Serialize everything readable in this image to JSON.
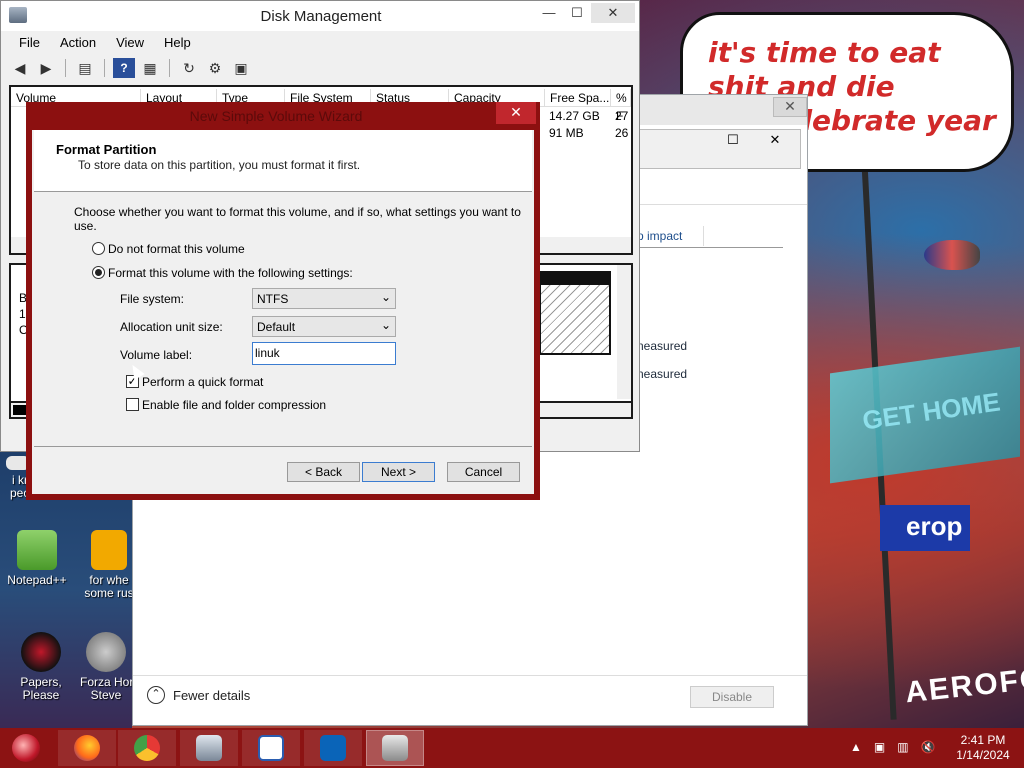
{
  "desktop": {
    "speech_bubble_text": "it's time to eat shit and die andcelebrate year",
    "sign_text": "GET HOME",
    "blue_sign_text": "erop",
    "aero_text": "AEROFOS",
    "icons": [
      {
        "label": "i kr\npeo",
        "icon": "text-doc-icon"
      },
      {
        "label": "Notepad++",
        "icon": "notepad-plus-icon"
      },
      {
        "label": "for whe\nsome rus",
        "icon": "dj-icon"
      },
      {
        "label": "Papers, Please",
        "icon": "papers-please-icon"
      },
      {
        "label": "Forza Hor\nSteve",
        "icon": "flash-icon"
      }
    ]
  },
  "disk_management": {
    "title": "Disk Management",
    "menu": [
      "File",
      "Action",
      "View",
      "Help"
    ],
    "columns": [
      "Volume",
      "Layout",
      "Type",
      "File System",
      "Status",
      "Capacity",
      "Free Spa...",
      "% F"
    ],
    "rows": [
      {
        "free_space": "14.27 GB",
        "percent_free": "27"
      },
      {
        "free_space": "91 MB",
        "percent_free": "26"
      }
    ],
    "graphic_left_labels": [
      "B",
      "1",
      "O"
    ]
  },
  "wizard": {
    "title": "New Simple Volume Wizard",
    "close_glyph": "✕",
    "heading": "Format Partition",
    "subheading": "To store data on this partition, you must format it first.",
    "intro": "Choose whether you want to format this volume, and if so, what settings you want to use.",
    "option_no_format": "Do not format this volume",
    "option_format": "Format this volume with the following settings:",
    "selected_option": "format",
    "file_system_label": "File system:",
    "file_system_value": "NTFS",
    "allocation_label": "Allocation unit size:",
    "allocation_value": "Default",
    "volume_label_label": "Volume label:",
    "volume_label_value": "linuk",
    "quick_format_label": "Perform a quick format",
    "quick_format_checked": true,
    "compression_label": "Enable file and folder compression",
    "compression_checked": false,
    "back_label": "< Back",
    "next_label": "Next >",
    "cancel_label": "Cancel"
  },
  "background_window": {
    "column_header": "p impact",
    "cells": [
      "neasured",
      "neasured"
    ],
    "fewer_details_label": "Fewer details",
    "disable_label": "Disable",
    "close_glyph": "✕",
    "max_glyph": "☐"
  },
  "taskbar": {
    "apps": [
      "firefox-icon",
      "chrome-icon",
      "disk-management-icon",
      "rdp-icon",
      "outlook-icon",
      "computer-management-icon"
    ],
    "time": "2:41 PM",
    "date": "1/14/2024"
  },
  "colors": {
    "wizard_border": "#8c1010",
    "taskbar": "#8c1313",
    "bubble_text": "#d12a2a"
  }
}
